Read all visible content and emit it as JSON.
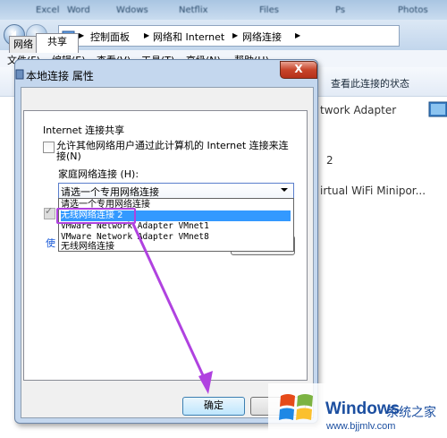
{
  "explorer": {
    "blurred_top": [
      "Excel",
      "Word",
      "Wdows",
      "Netflix",
      "Files",
      "Ps",
      "Photos"
    ],
    "breadcrumb": [
      "控制面板",
      "网络和 Internet",
      "网络连接"
    ],
    "menu": [
      "文件(F)",
      "编辑(E)",
      "查看(V)",
      "工具(T)",
      "高级(N)",
      "帮助(H)"
    ],
    "view_status": "查看此连接的状态",
    "adapter_text": "twork Adapter",
    "adapter_2": "2",
    "virtual_wifi": "irtual WiFi Minipor..."
  },
  "dialog": {
    "title": "本地连接 属性",
    "close_label": "X",
    "tabs": [
      "网络",
      "共享"
    ],
    "group_label": "Internet 连接共享",
    "allow_share_text": "允许其他网络用户通过此计算机的 Internet 连接来连接(N)",
    "home_network_label": "家庭网络连接 (H):",
    "select_value": "请选一个专用网络连接",
    "options": [
      "请选一个专用网络连接",
      "无线网络连接 2",
      "VMware Network Adapter VMnet1",
      "VMware Network Adapter VMnet8",
      "无线网络连接"
    ],
    "selected_index": 1,
    "link_partial": "使",
    "ok_label": "确定"
  },
  "colors": {
    "annotation": "#b042e0",
    "highlight": "#3399ff"
  },
  "watermark": {
    "brand": "Windows",
    "cn": "系统之家",
    "url": "www.bjjmlv.com"
  }
}
